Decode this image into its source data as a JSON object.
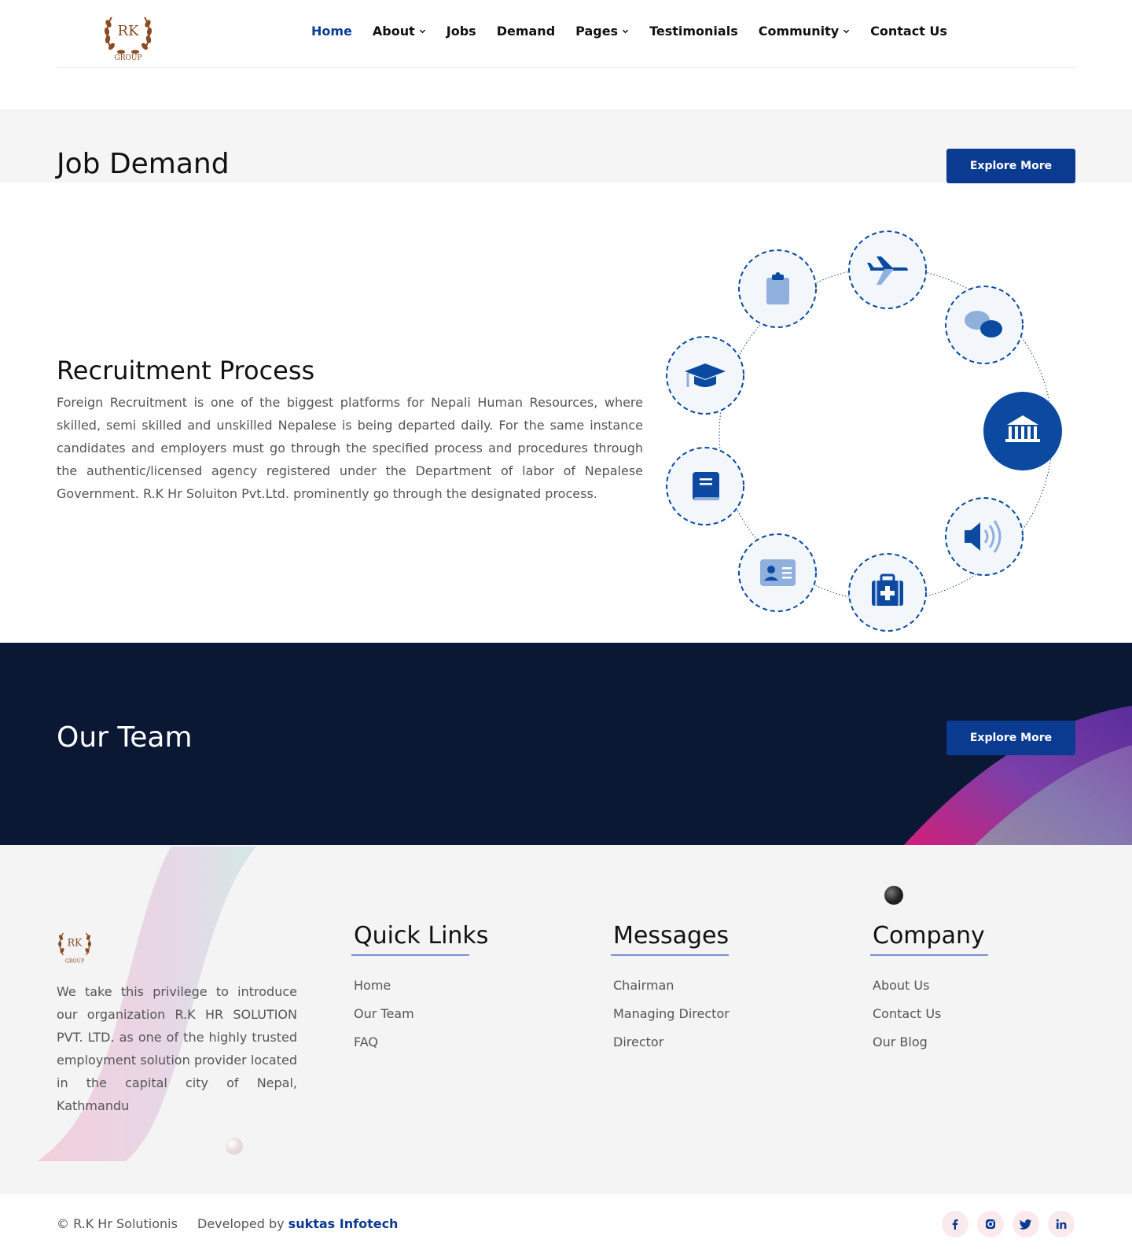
{
  "brand": {
    "logo_text": "RK",
    "logo_sub": "GROUP",
    "primary": "#0b3b91",
    "dark": "#0b1834"
  },
  "nav": [
    {
      "label": "Home",
      "dropdown": false,
      "active": true
    },
    {
      "label": "About",
      "dropdown": true,
      "active": false
    },
    {
      "label": "Jobs",
      "dropdown": false,
      "active": false
    },
    {
      "label": "Demand",
      "dropdown": false,
      "active": false
    },
    {
      "label": "Pages",
      "dropdown": true,
      "active": false
    },
    {
      "label": "Testimonials",
      "dropdown": false,
      "active": false
    },
    {
      "label": "Community",
      "dropdown": true,
      "active": false
    },
    {
      "label": "Contact Us",
      "dropdown": false,
      "active": false
    }
  ],
  "demand": {
    "title": "Job Demand",
    "button": "Explore More"
  },
  "recruitment": {
    "title": "Recruitment Process",
    "text": "Foreign Recruitment is one of the biggest platforms for Nepali Human Resources, where skilled, semi skilled and unskilled Nepalese is being departed daily. For the same instance candidates and employers must go through the specified process and procedures through the authentic/licensed agency registered under the Department of labor of Nepalese Government. R.K Hr Soluiton Pvt.Ltd. prominently go through the designated process.",
    "icons": [
      "clipboard-icon",
      "airplane-icon",
      "chat-icon",
      "bank-icon",
      "megaphone-icon",
      "medical-kit-icon",
      "id-card-icon",
      "book-icon",
      "graduation-cap-icon"
    ]
  },
  "team": {
    "title": "Our Team",
    "button": "Explore More"
  },
  "footer": {
    "about": "We take this privilege to introduce our organization R.K HR SOLUTION PVT. LTD. as one of the highly trusted employment solution provider located in the capital city of Nepal, Kathmandu",
    "quick_links": {
      "title": "Quick Links",
      "items": [
        "Home",
        "Our Team",
        "FAQ"
      ]
    },
    "messages": {
      "title": "Messages",
      "items": [
        "Chairman",
        "Managing Director",
        "Director"
      ]
    },
    "company": {
      "title": "Company",
      "items": [
        "About Us",
        "Contact Us",
        "Our Blog"
      ]
    }
  },
  "bottom": {
    "copyright": "© R.K Hr Solutionis",
    "developed_prefix": "Developed by",
    "developer": "suktas Infotech",
    "social": [
      "facebook-icon",
      "instagram-icon",
      "twitter-icon",
      "linkedin-icon"
    ]
  }
}
